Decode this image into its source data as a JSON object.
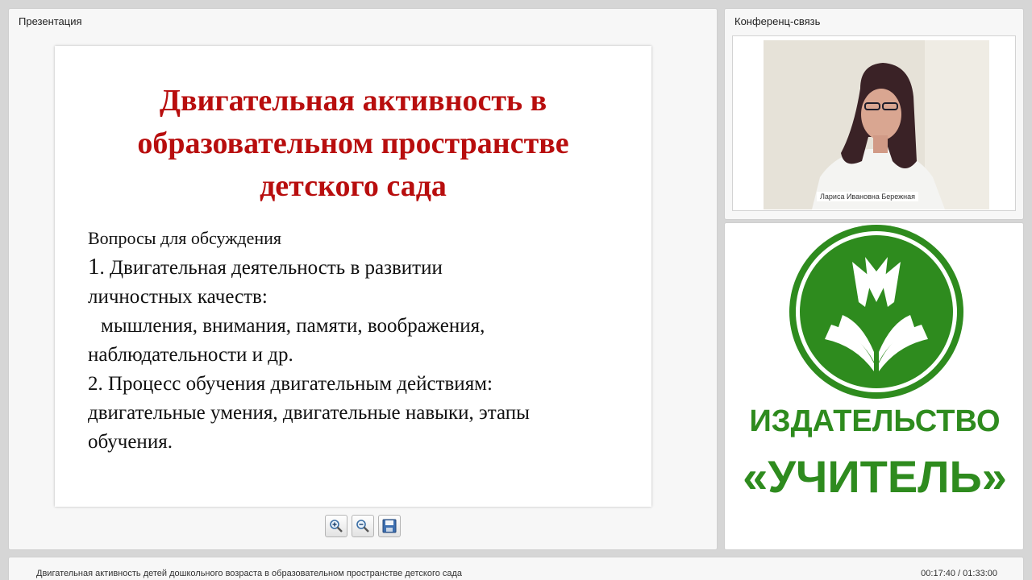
{
  "presentation": {
    "title": "Презентация",
    "slide": {
      "title_lines": [
        "Двигательная активность в",
        "образовательном пространстве",
        "детского сада"
      ],
      "heading": "Вопросы для обсуждения",
      "item1_number": "1",
      "item1_line1": ". Двигательная деятельность в развитии",
      "item1_line2": "личностных качеств:",
      "item1_line3": "мышления, внимания, памяти, воображения,",
      "item1_line4": "наблюдательности и др.",
      "item2_line1": "2. Процесс обучения двигательным действиям:",
      "item2_line2": "двигательные умения, двигательные навыки, этапы",
      "item2_line3": "обучения."
    },
    "toolbar": {
      "zoom_in_icon": "zoom-in-icon",
      "zoom_out_icon": "zoom-out-icon",
      "save_icon": "floppy-disk-icon"
    }
  },
  "conference": {
    "title": "Конференц-связь",
    "speaker_name": "Лариса Ивановна Бережная"
  },
  "publisher": {
    "line1": "ИЗДАТЕЛЬСТВО",
    "line2": "«УЧИТЕЛЬ»",
    "brand_color": "#2e8b1e"
  },
  "statusbar": {
    "lecture_title": "Двигательная активность детей дошкольного возраста в образовательном пространстве детского сада",
    "elapsed": "00:17:40",
    "total": "01:33:00",
    "separator": " / "
  }
}
